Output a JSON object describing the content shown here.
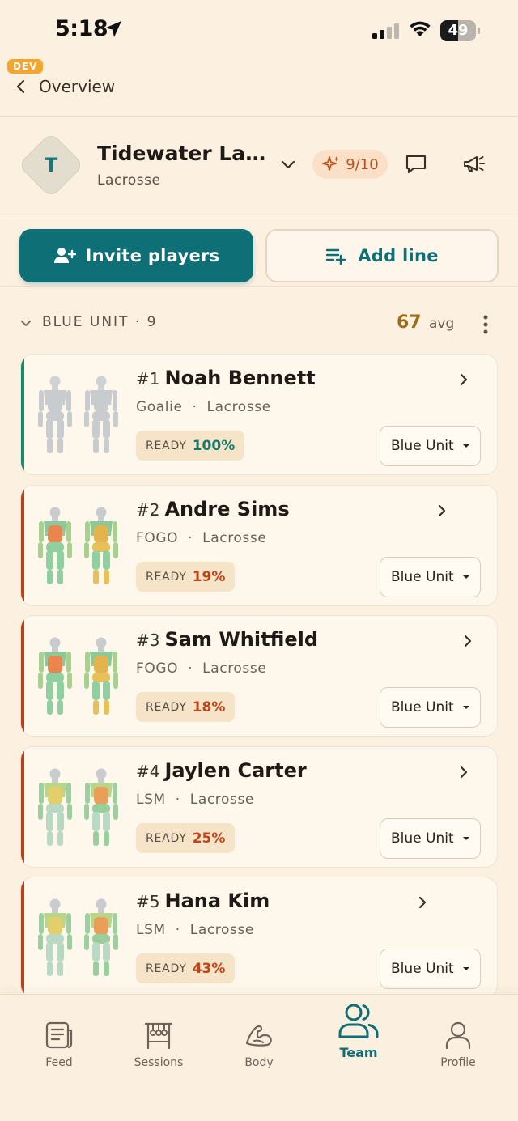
{
  "status_bar": {
    "time": "5:18",
    "battery": "49",
    "battery_level": 0.49
  },
  "dev_badge": "DEV",
  "nav": {
    "back_label": "Overview"
  },
  "team": {
    "avatar_letter": "T",
    "name": "Tidewater Lacr...",
    "sport": "Lacrosse",
    "score": "9/10"
  },
  "actions": {
    "invite_label": "Invite players",
    "add_line_label": "Add line"
  },
  "unit": {
    "title": "BLUE UNIT · 9",
    "avg_value": "67",
    "avg_label": "avg"
  },
  "players": [
    {
      "number": "#1",
      "name": "Noah Bennett",
      "position": "Goalie",
      "sport": "Lacrosse",
      "ready_label": "READY",
      "ready": "100%",
      "ready_color": "#137a6c",
      "accent": "#168a6a",
      "unit": "Blue Unit",
      "heat": "neutral"
    },
    {
      "number": "#2",
      "name": "Andre Sims",
      "position": "FOGO",
      "sport": "Lacrosse",
      "ready_label": "READY",
      "ready": "19%",
      "ready_color": "#c0441a",
      "accent": "#b6421a",
      "unit": "Blue Unit",
      "heat": "hot"
    },
    {
      "number": "#3",
      "name": "Sam Whitfield",
      "position": "FOGO",
      "sport": "Lacrosse",
      "ready_label": "READY",
      "ready": "18%",
      "ready_color": "#c0441a",
      "accent": "#b6421a",
      "unit": "Blue Unit",
      "heat": "hot"
    },
    {
      "number": "#4",
      "name": "Jaylen Carter",
      "position": "LSM",
      "sport": "Lacrosse",
      "ready_label": "READY",
      "ready": "25%",
      "ready_color": "#c0441a",
      "accent": "#b6421a",
      "unit": "Blue Unit",
      "heat": "warm"
    },
    {
      "number": "#5",
      "name": "Hana Kim",
      "position": "LSM",
      "sport": "Lacrosse",
      "ready_label": "READY",
      "ready": "43%",
      "ready_color": "#c0441a",
      "accent": "#b6421a",
      "unit": "Blue Unit",
      "heat": "warm"
    }
  ],
  "bottom_nav": [
    {
      "label": "Feed",
      "icon": "feed-icon"
    },
    {
      "label": "Sessions",
      "icon": "sessions-icon"
    },
    {
      "label": "Body",
      "icon": "body-icon"
    },
    {
      "label": "Team",
      "icon": "team-icon",
      "active": true
    },
    {
      "label": "Profile",
      "icon": "profile-icon"
    }
  ],
  "colors": {
    "primary": "#0e6f76",
    "background": "#fcf1e1",
    "card": "#fef8ec",
    "warning": "#c0441a"
  }
}
